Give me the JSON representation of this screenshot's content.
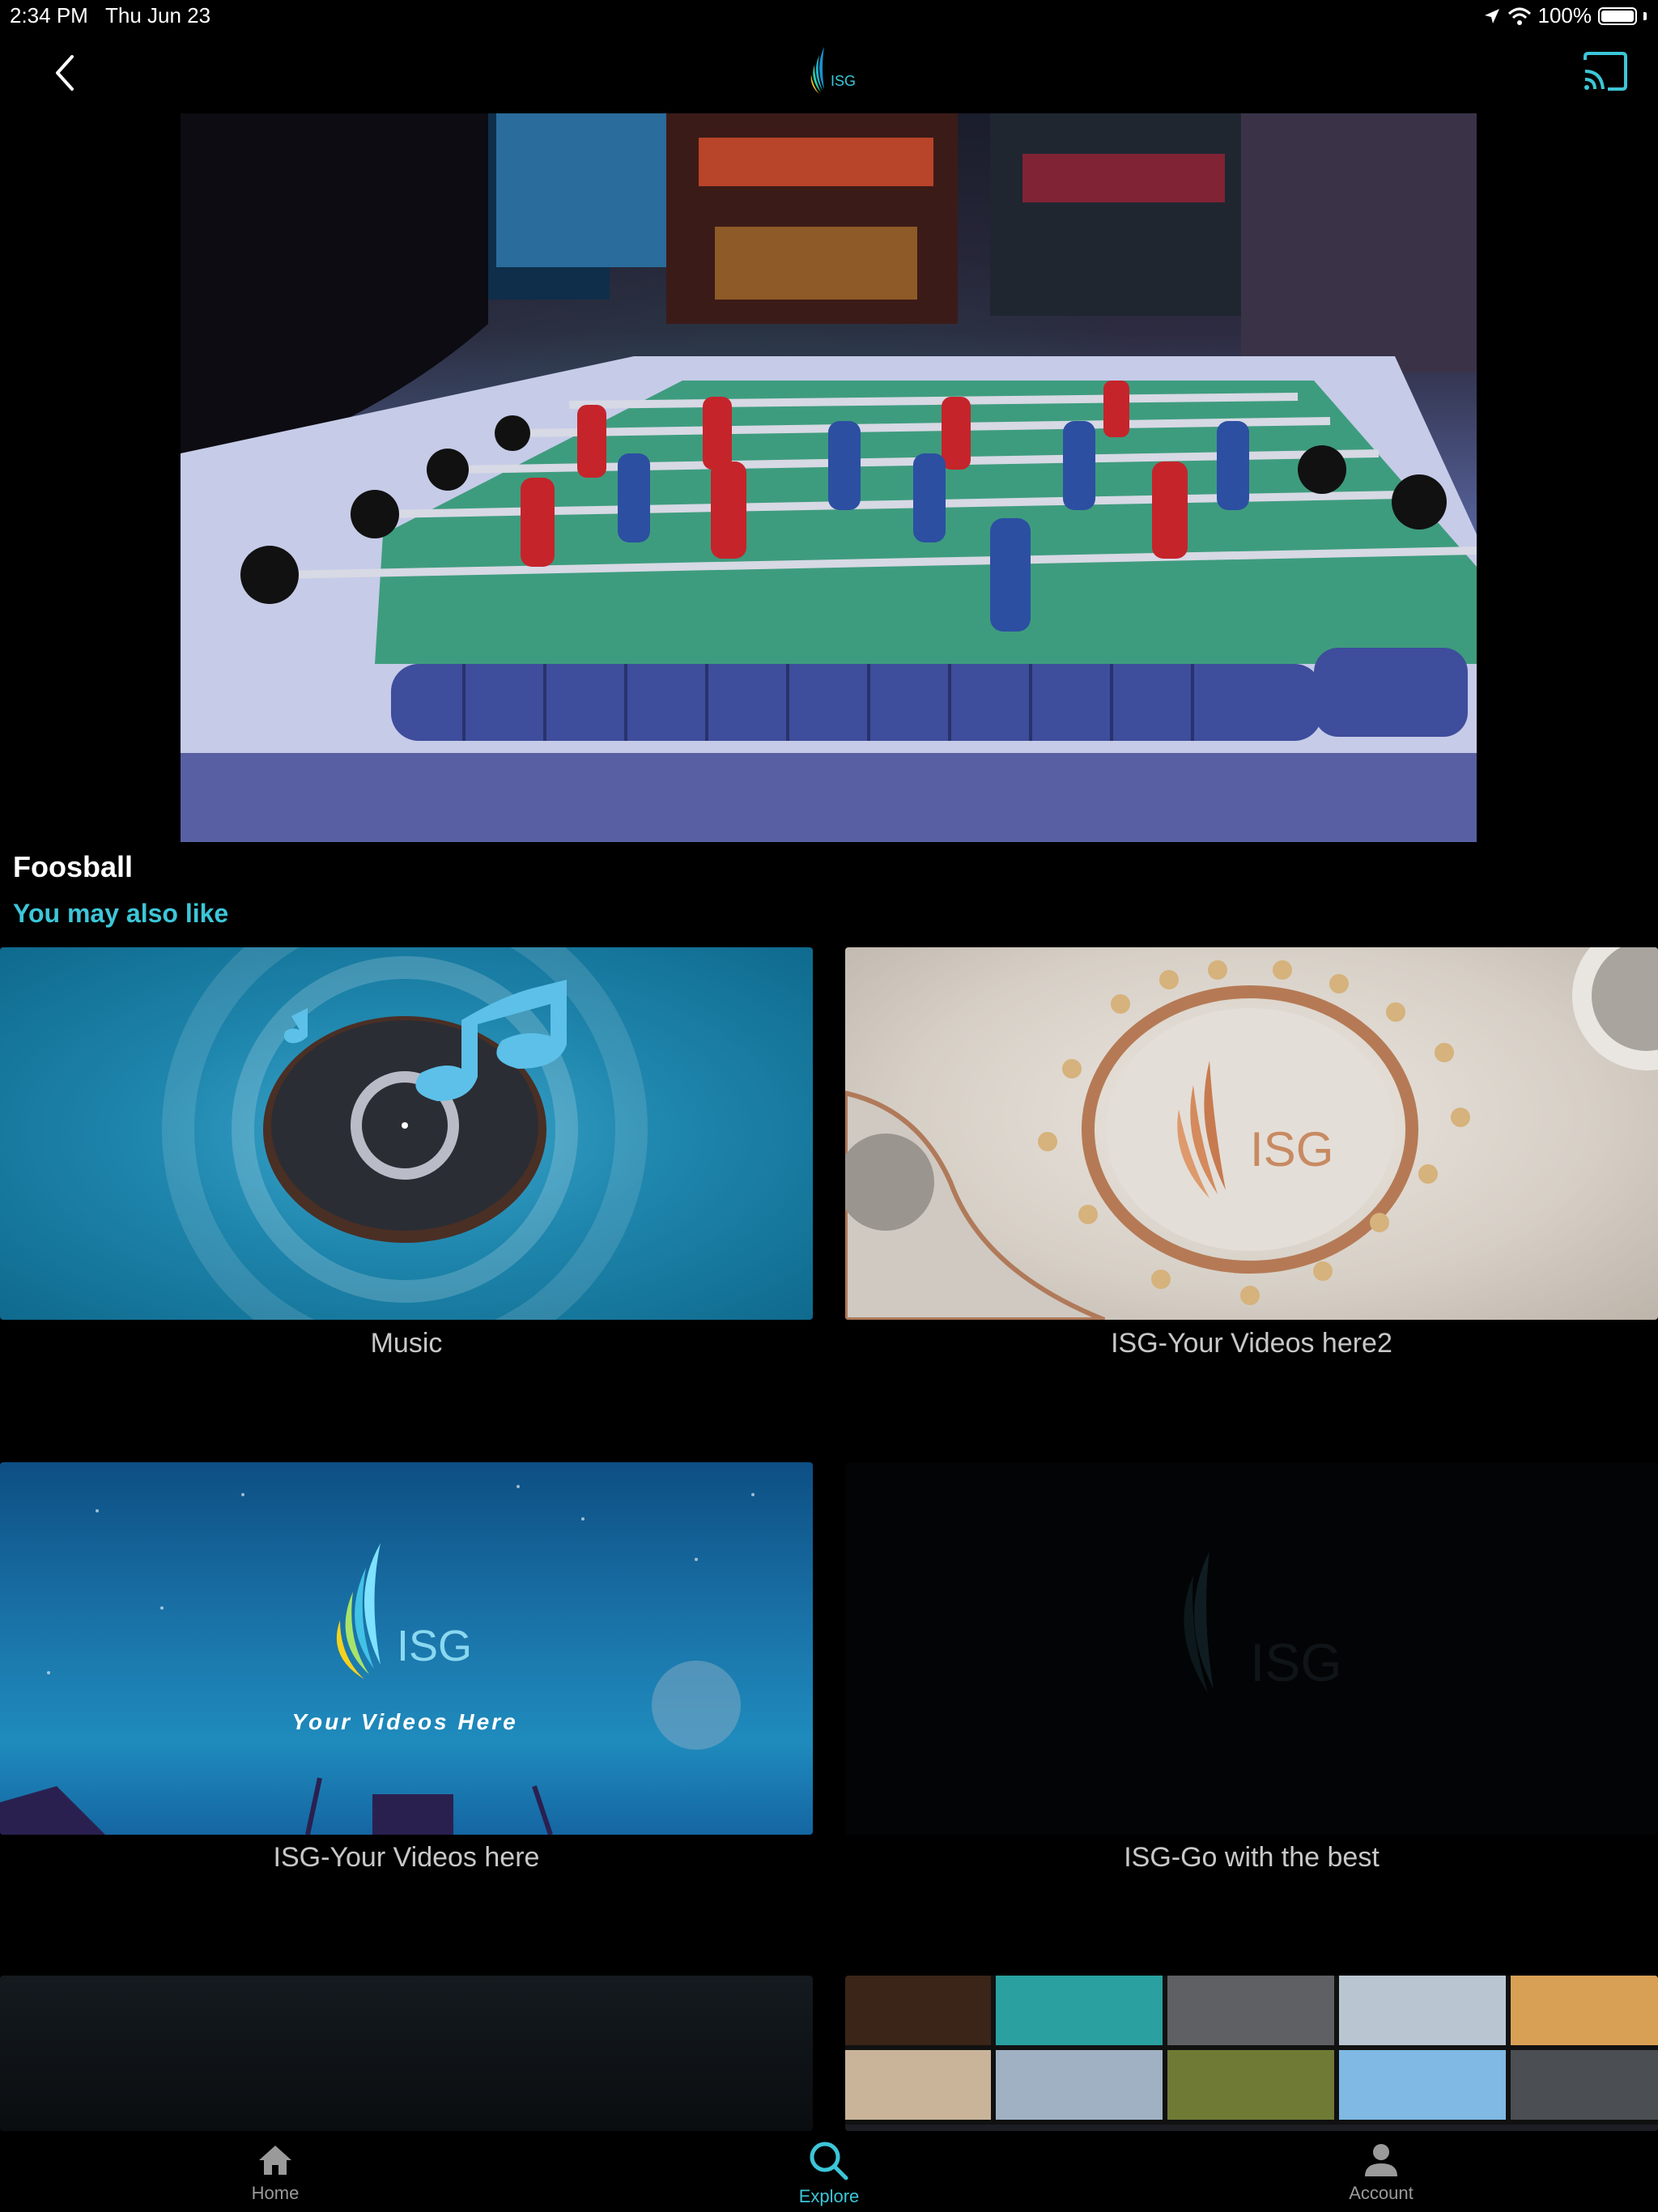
{
  "status_bar": {
    "time": "2:34 PM",
    "date": "Thu Jun 23",
    "battery": "100%"
  },
  "nav": {
    "logo_text": "ISG",
    "back_icon": "chevron-left-icon",
    "cast_icon": "cast-icon"
  },
  "video": {
    "title": "Foosball"
  },
  "recommendations": {
    "heading": "You may also like",
    "items": [
      {
        "label": "Music"
      },
      {
        "label": "ISG-Your Videos here2"
      },
      {
        "label": "ISG-Your Videos here",
        "thumb_logo": "ISG",
        "thumb_text": "Your Videos Here"
      },
      {
        "label": "ISG-Go with the best",
        "thumb_logo": "ISG"
      }
    ]
  },
  "tab_bar": {
    "tabs": [
      {
        "label": "Home",
        "icon": "home-icon",
        "active": false
      },
      {
        "label": "Explore",
        "icon": "search-icon",
        "active": true
      },
      {
        "label": "Account",
        "icon": "person-icon",
        "active": false
      }
    ]
  },
  "colors": {
    "accent": "#3cc6d8",
    "background": "#000000",
    "inactive_tab": "#9a9a9a"
  }
}
